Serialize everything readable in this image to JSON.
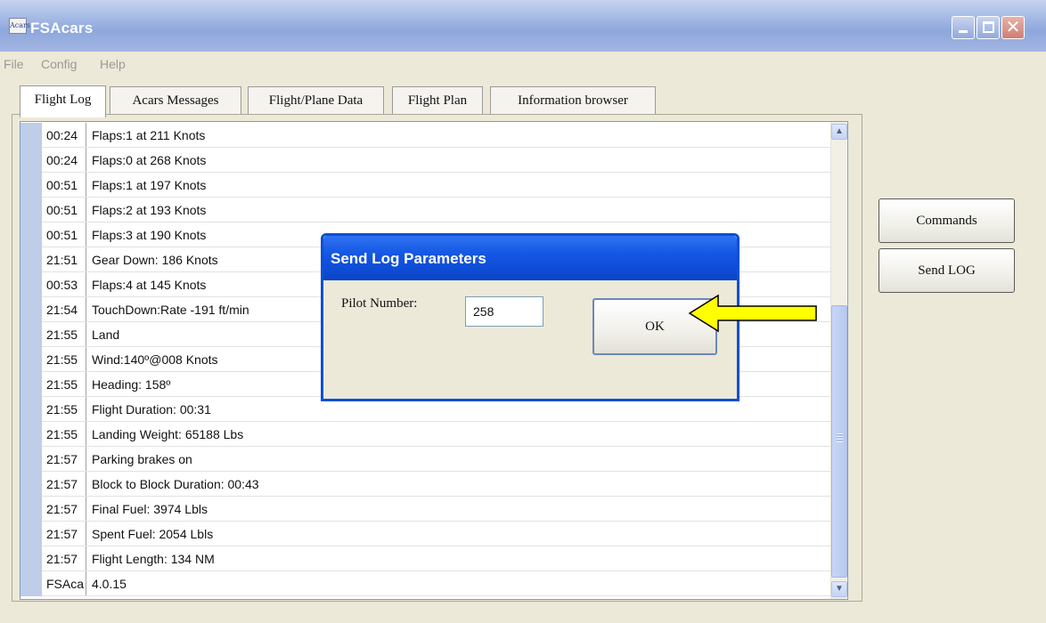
{
  "window": {
    "title": "FSAcars",
    "icon_name": "app-icon",
    "icon_text": "Acars"
  },
  "menu": {
    "items": [
      "File",
      "Config",
      "Help"
    ]
  },
  "tabs": [
    {
      "label": "Flight Log",
      "active": true
    },
    {
      "label": "Acars Messages",
      "active": false
    },
    {
      "label": "Flight/Plane Data",
      "active": false
    },
    {
      "label": "Flight Plan",
      "active": false
    },
    {
      "label": "Information browser",
      "active": false
    }
  ],
  "log": {
    "rows": [
      {
        "time": "00:24",
        "message": "Flaps:1 at 211 Knots"
      },
      {
        "time": "00:24",
        "message": "Flaps:0 at 268 Knots"
      },
      {
        "time": "00:51",
        "message": "Flaps:1 at 197 Knots"
      },
      {
        "time": "00:51",
        "message": "Flaps:2 at 193 Knots"
      },
      {
        "time": "00:51",
        "message": "Flaps:3 at 190 Knots"
      },
      {
        "time": "21:51",
        "message": "Gear Down: 186 Knots"
      },
      {
        "time": "00:53",
        "message": "Flaps:4 at 145 Knots"
      },
      {
        "time": "21:54",
        "message": "TouchDown:Rate -191 ft/min"
      },
      {
        "time": "21:55",
        "message": "Land"
      },
      {
        "time": "21:55",
        "message": "Wind:140º@008 Knots"
      },
      {
        "time": "21:55",
        "message": "Heading: 158º"
      },
      {
        "time": "21:55",
        "message": "Flight Duration: 00:31"
      },
      {
        "time": "21:55",
        "message": "Landing Weight: 65188 Lbs"
      },
      {
        "time": "21:57",
        "message": "Parking brakes on"
      },
      {
        "time": "21:57",
        "message": "Block to Block Duration: 00:43"
      },
      {
        "time": "21:57",
        "message": "Final Fuel: 3974 Lbls"
      },
      {
        "time": "21:57",
        "message": "Spent Fuel: 2054 Lbls"
      },
      {
        "time": "21:57",
        "message": "Flight Length: 134 NM"
      },
      {
        "time": "FSAca",
        "message": "4.0.15"
      }
    ]
  },
  "side_buttons": {
    "commands": "Commands",
    "send_log": "Send LOG"
  },
  "dialog": {
    "title": "Send Log Parameters",
    "pilot_label": "Pilot Number:",
    "pilot_value": "258",
    "ok_label": "OK"
  },
  "colors": {
    "arrow": "#ffff00",
    "dialog_title": "#1457e3"
  }
}
